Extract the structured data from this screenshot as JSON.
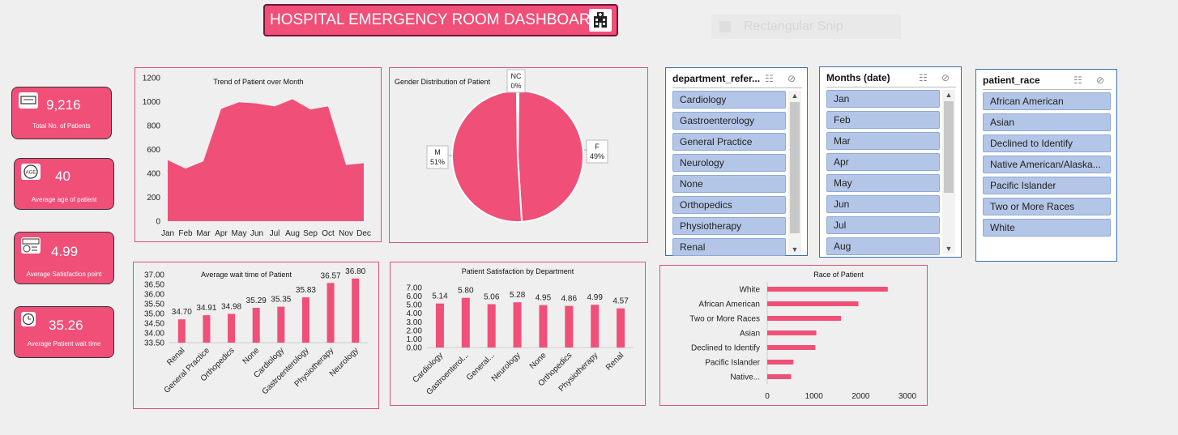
{
  "title": "HOSPITAL EMERGENCY ROOM DASHBOARD",
  "snip_label": "Rectangular Snip",
  "kpis": [
    {
      "value": "9,216",
      "label": "Total No. of Patients",
      "icon": "patients-icon"
    },
    {
      "value": "40",
      "label": "Average age of patient",
      "icon": "age-icon"
    },
    {
      "value": "4.99",
      "label": "Average Satisfaction point",
      "icon": "satisfaction-icon"
    },
    {
      "value": "35.26",
      "label": "Average Patient wait time",
      "icon": "clock-icon"
    }
  ],
  "colors": {
    "accent": "#f04f78",
    "slicer_item": "#b4c6e7",
    "slicer_border": "#3b6fb0"
  },
  "slicers": {
    "department": {
      "header": "department_refer...",
      "items": [
        "Cardiology",
        "Gastroenterology",
        "General Practice",
        "Neurology",
        "None",
        "Orthopedics",
        "Physiotherapy",
        "Renal"
      ]
    },
    "months": {
      "header": "Months (date)",
      "items": [
        "Jan",
        "Feb",
        "Mar",
        "Apr",
        "May",
        "Jun",
        "Jul",
        "Aug"
      ]
    },
    "race": {
      "header": "patient_race",
      "items": [
        "African American",
        "Asian",
        "Declined to Identify",
        "Native American/Alaska...",
        "Pacific Islander",
        "Two or More Races",
        "White"
      ]
    }
  },
  "chart_data": [
    {
      "type": "area",
      "title": "Trend of Patient over Month",
      "categories": [
        "Jan",
        "Feb",
        "Mar",
        "Apr",
        "May",
        "Jun",
        "Jul",
        "Aug",
        "Sep",
        "Oct",
        "Nov",
        "Dec"
      ],
      "values": [
        510,
        440,
        500,
        940,
        995,
        985,
        960,
        1020,
        935,
        960,
        470,
        485
      ],
      "ylim": [
        0,
        1200
      ],
      "yticks": [
        "0",
        "200",
        "400",
        "600",
        "800",
        "1000",
        "1200"
      ]
    },
    {
      "type": "pie",
      "title": "Gender Distribution of Patient",
      "slices": [
        {
          "name": "M",
          "value": 51,
          "label": "51%"
        },
        {
          "name": "F",
          "value": 49,
          "label": "49%"
        },
        {
          "name": "NC",
          "value": 0.4,
          "label": "0%"
        }
      ]
    },
    {
      "type": "bar",
      "title": "Average wait time of Patient",
      "categories": [
        "Renal",
        "General Practice",
        "Orthopedics",
        "None",
        "Cardiology",
        "Gastroenterology",
        "Physiotherapy",
        "Neurology"
      ],
      "values": [
        34.7,
        34.91,
        34.98,
        35.29,
        35.35,
        35.83,
        36.57,
        36.8
      ],
      "labels": [
        "34.70",
        "34.91",
        "34.98",
        "35.29",
        "35.35",
        "35.83",
        "36.57",
        "36.80"
      ],
      "ylim": [
        33.5,
        37.0
      ],
      "yticks": [
        "33.50",
        "34.00",
        "34.50",
        "35.00",
        "35.50",
        "36.00",
        "36.50",
        "37.00"
      ]
    },
    {
      "type": "bar",
      "title": "Patient Satisfaction by Department",
      "categories": [
        "Cardiology",
        "Gastroenterol...",
        "General...",
        "Neurology",
        "None",
        "Orthopedics",
        "Physiotherapy",
        "Renal"
      ],
      "values": [
        5.14,
        5.8,
        5.06,
        5.28,
        4.95,
        4.86,
        4.99,
        4.57
      ],
      "labels": [
        "5.14",
        "5.80",
        "5.06",
        "5.28",
        "4.95",
        "4.86",
        "4.99",
        "4.57"
      ],
      "ylim": [
        0,
        7
      ],
      "yticks": [
        "0.00",
        "1.00",
        "2.00",
        "3.00",
        "4.00",
        "5.00",
        "6.00",
        "7.00"
      ]
    },
    {
      "type": "bar",
      "orientation": "horizontal",
      "title": "Race of Patient",
      "categories": [
        "White",
        "African American",
        "Two or More Races",
        "Asian",
        "Declined to Identify",
        "Pacific Islander",
        "Native..."
      ],
      "values": [
        2580,
        1950,
        1580,
        1050,
        1030,
        560,
        510
      ],
      "xlim": [
        0,
        3000
      ],
      "xticks": [
        "0",
        "1000",
        "2000",
        "3000"
      ]
    }
  ]
}
